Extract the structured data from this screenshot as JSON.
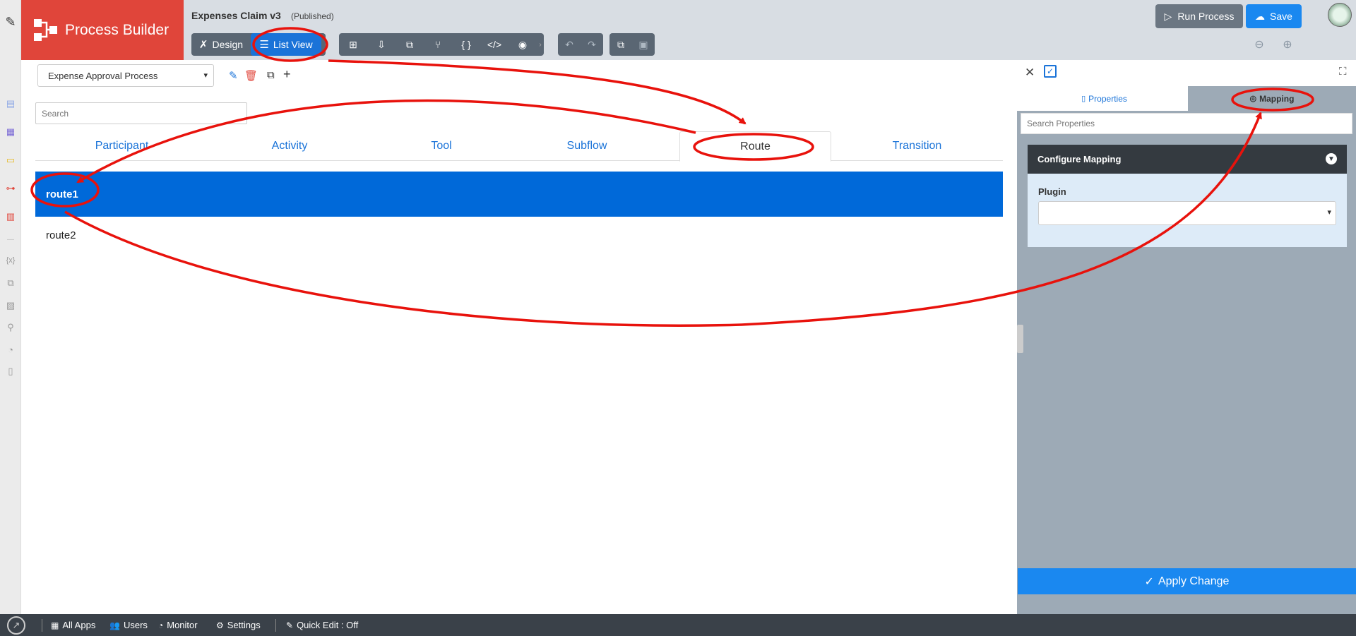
{
  "header": {
    "brand": "Process Builder",
    "app_title": "Expenses Claim v3",
    "app_status": "(Published)",
    "toolbar": {
      "design": "Design",
      "list_view": "List View"
    },
    "run_process": "Run Process",
    "save": "Save"
  },
  "main": {
    "process_select": "Expense Approval Process",
    "search_placeholder": "Search",
    "tabs": [
      "Participant",
      "Activity",
      "Tool",
      "Subflow",
      "Route",
      "Transition"
    ],
    "active_tab": "Route",
    "rows": [
      "route1",
      "route2"
    ],
    "selected_row": "route1"
  },
  "right_panel": {
    "tabs": {
      "properties": "Properties",
      "mapping": "Mapping"
    },
    "active_tab": "Mapping",
    "search_placeholder": "Search Properties",
    "section_title": "Configure Mapping",
    "plugin_label": "Plugin",
    "plugin_value": "",
    "apply_button": "Apply Change"
  },
  "bottom_bar": {
    "all_apps": "All Apps",
    "users": "Users",
    "monitor": "Monitor",
    "settings": "Settings",
    "quick_edit": "Quick Edit : Off"
  },
  "colors": {
    "brand": "#e0453a",
    "accent": "#1a73d8",
    "selected_row": "#0069d9",
    "annotation": "#e8120c"
  }
}
